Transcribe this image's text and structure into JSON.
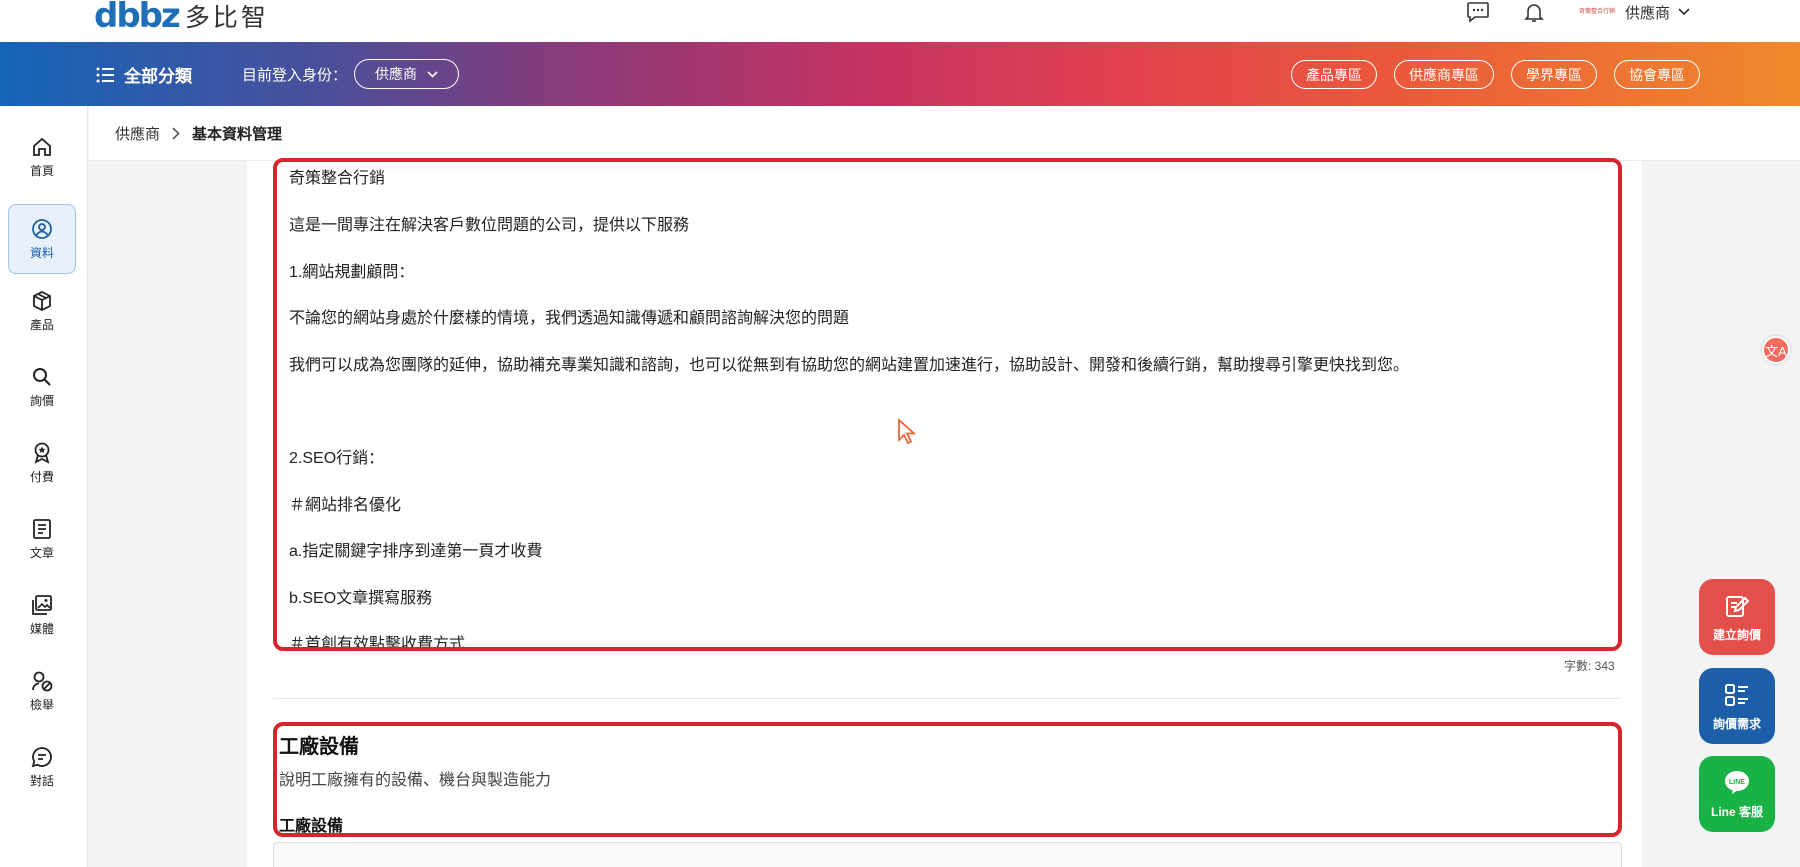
{
  "header": {
    "logo_mark": "dbbz",
    "logo_text": "多比智",
    "user_name": "供應商",
    "user_logo_text": "奇策整合行銷"
  },
  "nav": {
    "all_categories": "全部分類",
    "role_label": "目前登入身份：",
    "role_value": "供應商",
    "links": [
      "產品專區",
      "供應商專區",
      "學界專區",
      "協會專區"
    ]
  },
  "sidebar": {
    "items": [
      {
        "label": "首頁",
        "icon": "home-icon"
      },
      {
        "label": "資料",
        "icon": "user-circle-icon",
        "active": true
      },
      {
        "label": "產品",
        "icon": "box-icon"
      },
      {
        "label": "詢價",
        "icon": "search-icon"
      },
      {
        "label": "付費",
        "icon": "badge-icon"
      },
      {
        "label": "文章",
        "icon": "article-icon"
      },
      {
        "label": "媒體",
        "icon": "media-icon"
      },
      {
        "label": "檢舉",
        "icon": "report-icon"
      },
      {
        "label": "對話",
        "icon": "chat-icon"
      }
    ]
  },
  "breadcrumb": {
    "root": "供應商",
    "current": "基本資料管理"
  },
  "description": {
    "lines": [
      "奇策整合行銷",
      "這是一間專注在解決客戶數位問題的公司，提供以下服務",
      "1.網站規劃顧問：",
      "不論您的網站身處於什麼樣的情境，我們透過知識傳遞和顧問諮詢解決您的問題",
      "我們可以成為您團隊的延伸，協助補充專業知識和諮詢，也可以從無到有協助您的網站建置加速進行，協助設計、開發和後續行銷，幫助搜尋引擎更快找到您。",
      "2.SEO行銷：",
      "＃網站排名優化",
      "a.指定關鍵字排序到達第一頁才收費",
      "b.SEO文章撰寫服務",
      "＃首創有效點擊收費方式"
    ],
    "word_count": "字數: 343"
  },
  "factory": {
    "title": "工廠設備",
    "description": "說明工廠擁有的設備、機台與製造能力",
    "subtitle": "工廠設備"
  },
  "fabs": {
    "create_inquiry": "建立詢價",
    "inquiry_needs": "詢價需求",
    "line_service": "Line 客服",
    "line_badge": "LINE"
  },
  "translate_glyph": "文A"
}
